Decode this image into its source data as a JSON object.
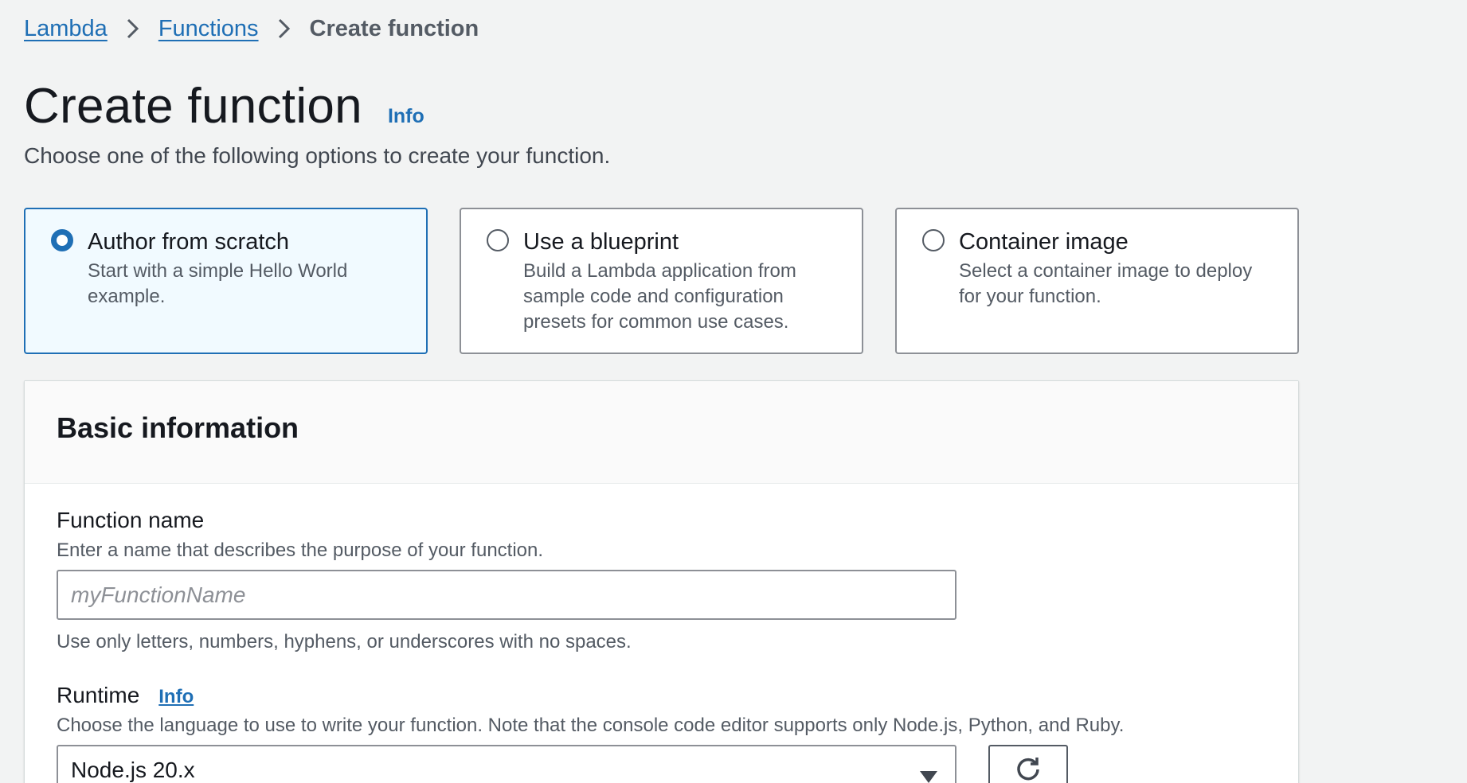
{
  "breadcrumb": {
    "items": [
      "Lambda",
      "Functions"
    ],
    "current": "Create function"
  },
  "header": {
    "title": "Create function",
    "info": "Info",
    "subtitle": "Choose one of the following options to create your function."
  },
  "options": [
    {
      "title": "Author from scratch",
      "description": "Start with a simple Hello World example.",
      "selected": true
    },
    {
      "title": "Use a blueprint",
      "description": "Build a Lambda application from sample code and configuration presets for common use cases.",
      "selected": false
    },
    {
      "title": "Container image",
      "description": "Select a container image to deploy for your function.",
      "selected": false
    }
  ],
  "basic_info": {
    "title": "Basic information",
    "function_name": {
      "label": "Function name",
      "description": "Enter a name that describes the purpose of your function.",
      "placeholder": "myFunctionName",
      "value": "",
      "constraint": "Use only letters, numbers, hyphens, or underscores with no spaces."
    },
    "runtime": {
      "label": "Runtime",
      "info": "Info",
      "description": "Choose the language to use to write your function. Note that the console code editor supports only Node.js, Python, and Ruby.",
      "selected": "Node.js 20.x"
    }
  },
  "icons": {
    "breadcrumb_separator": "chevron-right-icon",
    "select_caret": "caret-down-icon",
    "refresh": "refresh-icon"
  },
  "colors": {
    "link": "#1f6fb5",
    "selected_border": "#1f6fb5",
    "selected_bg": "#f1faff",
    "page_bg": "#f2f3f3"
  }
}
